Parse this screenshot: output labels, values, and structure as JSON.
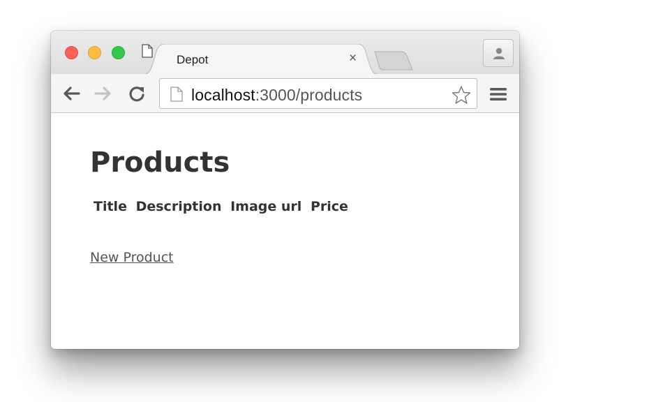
{
  "browser": {
    "tab": {
      "title": "Depot",
      "close_glyph": "×",
      "icon": "page-icon"
    },
    "new_tab_icon": "new-tab-icon",
    "profile_icon": "person-icon",
    "toolbar": {
      "back_icon": "back-arrow-icon",
      "forward_icon": "forward-arrow-icon",
      "reload_icon": "reload-icon",
      "address": {
        "host": "localhost",
        "rest": ":3000/products"
      },
      "star_icon": "star-icon",
      "menu_icon": "hamburger-menu-icon"
    },
    "traffic_lights": {
      "close_color": "#fc605b",
      "minimize_color": "#fdbc40",
      "maximize_color": "#34c84a"
    }
  },
  "page": {
    "title": "Products",
    "table_headers": [
      "Title",
      "Description",
      "Image url",
      "Price"
    ],
    "new_product_link": "New Product"
  }
}
